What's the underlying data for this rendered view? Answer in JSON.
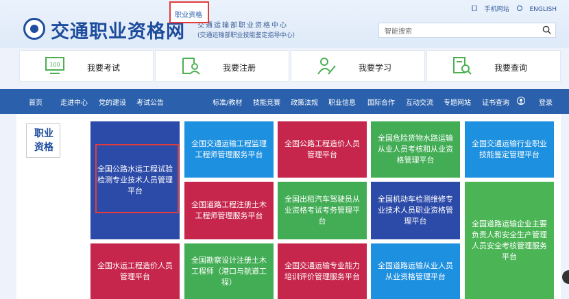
{
  "header": {
    "title": "交通职业资格网",
    "subtitle_line1": "交通运输部职业资格中心",
    "subtitle_line2": "(交通运输部职业技能鉴定指导中心)",
    "top_links": [
      "手机网站",
      "ENGLISH"
    ],
    "search_placeholder": "智能搜索"
  },
  "quick_tiles": [
    {
      "label": "我要考试",
      "icon": "exam-icon"
    },
    {
      "label": "我要注册",
      "icon": "register-icon"
    },
    {
      "label": "我要学习",
      "icon": "study-icon"
    },
    {
      "label": "我要查询",
      "icon": "query-icon"
    }
  ],
  "nav": {
    "items": [
      "首页",
      "走进中心",
      "党的建设",
      "考试公告",
      "职业资格",
      "标准/教材",
      "技能竞赛",
      "政策法规",
      "职业信息",
      "国际合作",
      "互动交流",
      "专题网站",
      "证书查询",
      "登录"
    ],
    "active": "职业资格"
  },
  "section_title": "职业资格",
  "cards": [
    {
      "label": "全国公路水运工程试验检测专业技术人员管理平台",
      "color": "navy"
    },
    {
      "label": "全国交通运输工程监理工程师管理服务平台",
      "color": "blue"
    },
    {
      "label": "全国公路工程造价人员管理平台",
      "color": "red"
    },
    {
      "label": "全国危险货物水路运输从业人员考核和从业资格管理平台",
      "color": "green"
    },
    {
      "label": "全国交通运输行业职业技能鉴定管理平台",
      "color": "blue"
    },
    {
      "label": "全国道路工程注册土木工程师管理服务平台",
      "color": "red"
    },
    {
      "label": "全国出租汽车驾驶员从业资格考试考务管理平台",
      "color": "green"
    },
    {
      "label": "全国机动车检测维修专业技术人员职业资格管理平台",
      "color": "navy"
    },
    {
      "label": "全国道路运输企业主要负责人和安全生产管理人员安全考核管理服务平台",
      "color": "green"
    },
    {
      "label": "全国水运工程造价人员管理平台",
      "color": "red"
    },
    {
      "label": "全国勘察设计注册土木工程师（港口与航道工程）",
      "color": "green"
    },
    {
      "label": "全国交通运输专业能力培训评价管理服务平台",
      "color": "red"
    },
    {
      "label": "全国道路运输从业人员从业资格管理平台",
      "color": "blue"
    }
  ]
}
